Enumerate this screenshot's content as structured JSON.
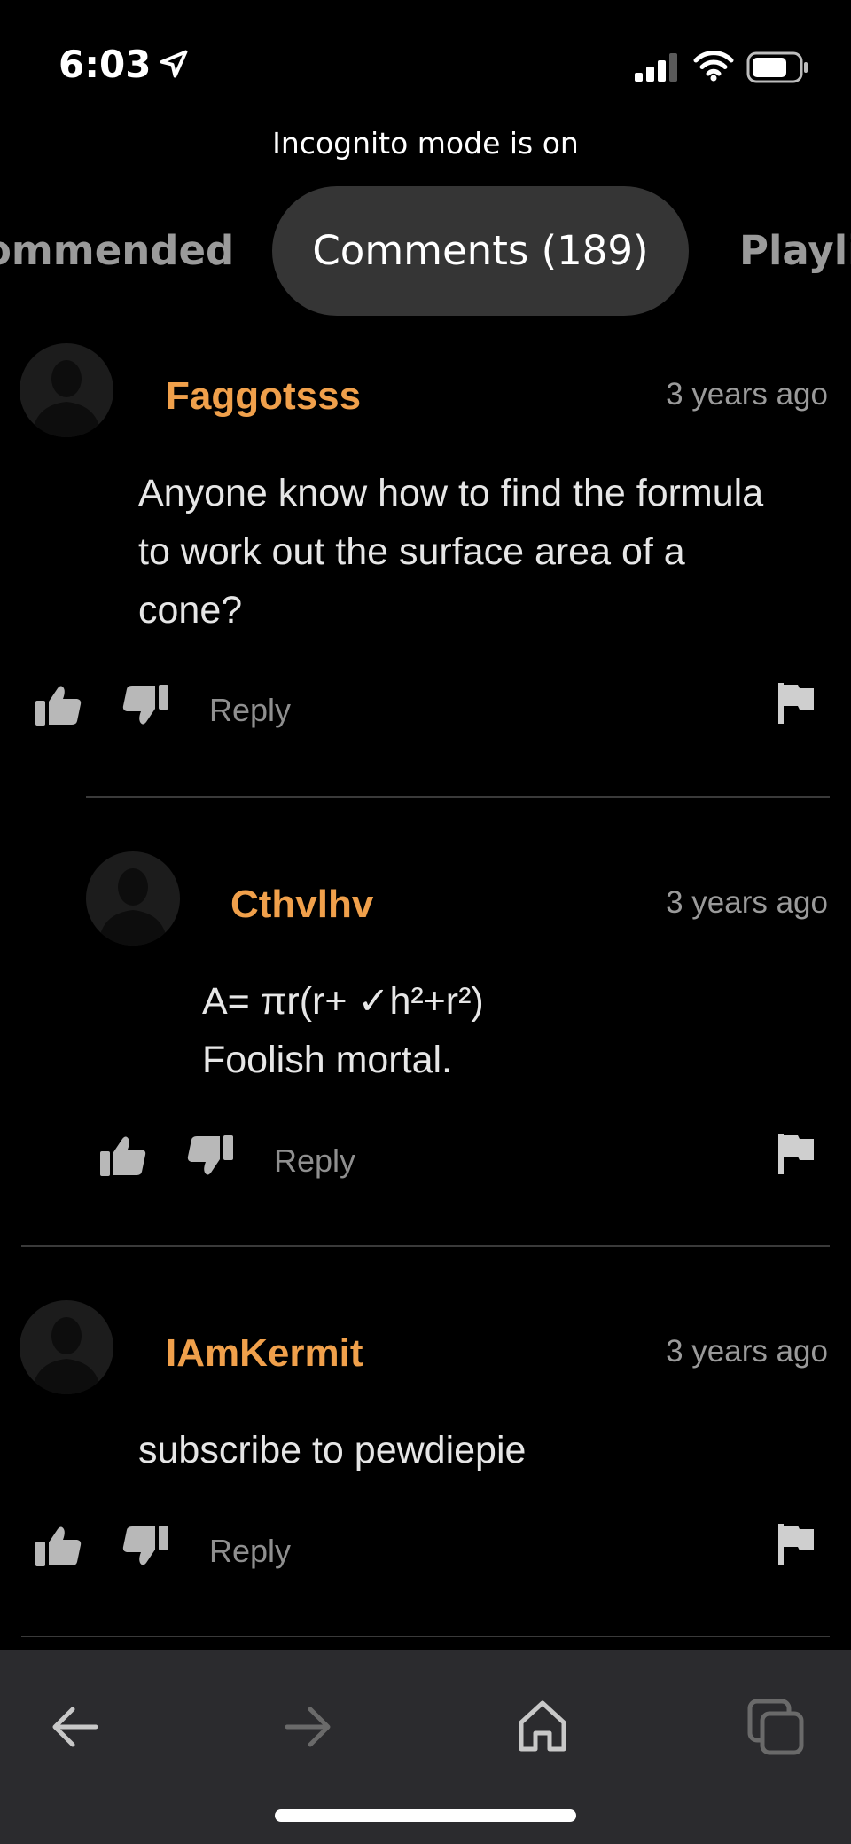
{
  "status_bar": {
    "time": "6:03",
    "incognito_label": "Incognito mode is on"
  },
  "tabs": [
    {
      "label": "ommended"
    },
    {
      "label": "Comments (189)",
      "active": true
    },
    {
      "label": "Playli"
    }
  ],
  "comments": [
    {
      "author": "Faggotsss",
      "time_ago": "3 years ago",
      "lines": [
        "Anyone know how to find the formula",
        "to work out the surface area of a",
        "cone?"
      ],
      "reply_label": "Reply"
    },
    {
      "author": "Cthvlhv",
      "time_ago": "3 years ago",
      "lines": [
        "A= πr(r+ ✓h²+r²)",
        "Foolish mortal."
      ],
      "reply_label": "Reply",
      "is_reply": true
    },
    {
      "author": "IAmKermit",
      "time_ago": "3 years ago",
      "lines": [
        "subscribe to pewdiepie"
      ],
      "reply_label": "Reply"
    }
  ],
  "colors": {
    "author": "#f0a04b",
    "background": "#000000",
    "active_tab": "#353535",
    "bottom_bar": "#2b2b2e"
  },
  "icons": {
    "status": [
      "location-arrow-icon",
      "signal-icon",
      "wifi-icon",
      "battery-icon"
    ],
    "actions": [
      "thumbs-up-icon",
      "thumbs-down-icon",
      "flag-icon"
    ],
    "nav": [
      "back-arrow-icon",
      "forward-arrow-icon",
      "home-icon",
      "tabs-icon"
    ]
  }
}
